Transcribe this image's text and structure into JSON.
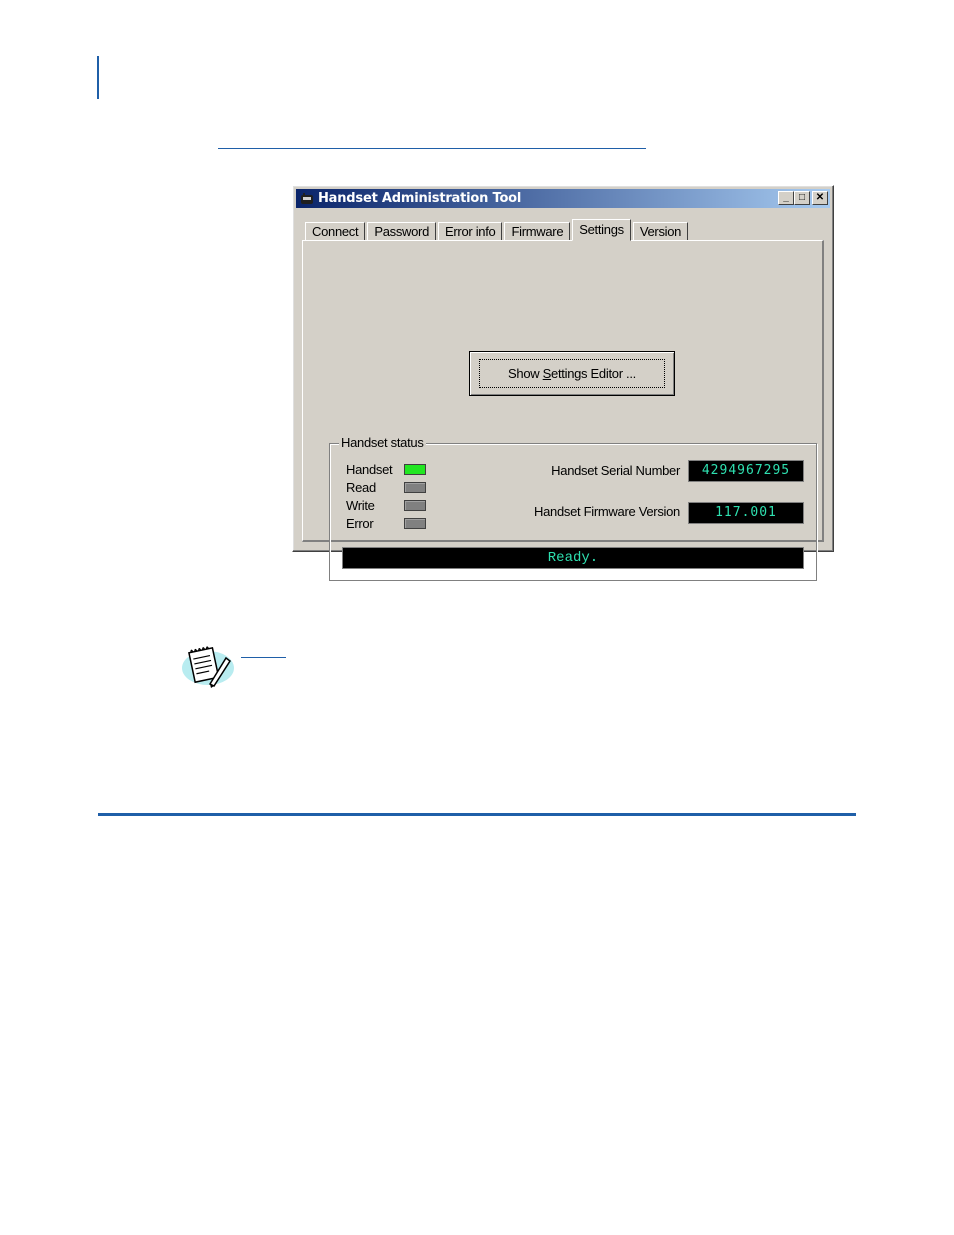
{
  "window": {
    "title": "Handset Administration Tool",
    "controls": {
      "minimize": "_",
      "maximize": "□",
      "close": "✕"
    }
  },
  "tabs": [
    {
      "label": "Connect",
      "active": false
    },
    {
      "label": "Password",
      "active": false
    },
    {
      "label": "Error info",
      "active": false
    },
    {
      "label": "Firmware",
      "active": false
    },
    {
      "label": "Settings",
      "active": true
    },
    {
      "label": "Version",
      "active": false
    }
  ],
  "settings_tab": {
    "show_editor_button": {
      "before": "Show ",
      "mnemonic": "S",
      "after": "ettings Editor ..."
    }
  },
  "handset_status": {
    "group_title": "Handset status",
    "indicators": [
      {
        "label": "Handset",
        "on": true
      },
      {
        "label": "Read",
        "on": false
      },
      {
        "label": "Write",
        "on": false
      },
      {
        "label": "Error",
        "on": false
      }
    ],
    "serial_number_label": "Handset Serial Number",
    "serial_number_value": "4294967295",
    "firmware_version_label": "Handset Firmware Version",
    "firmware_version_value": "117.001",
    "status_message": "Ready."
  },
  "colors": {
    "accent_rule": "#1f5fa8",
    "lcd_text": "#2ee0b0",
    "led_on": "#22e622",
    "led_off": "#808080"
  },
  "icons": {
    "note": "note-pad-pencil-icon",
    "app": "handset-app-icon"
  }
}
